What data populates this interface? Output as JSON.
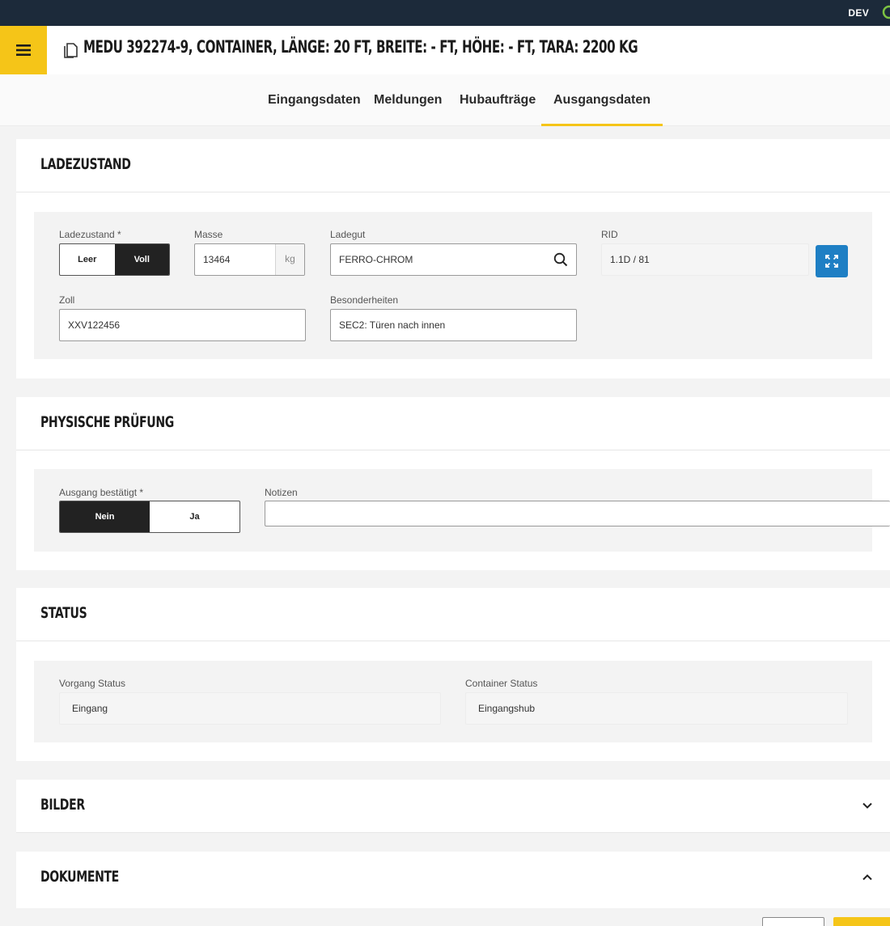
{
  "topbar": {
    "env": "DEV"
  },
  "header": {
    "title": "MEDU 392274-9, Container, Länge: 20 ft, Breite: - ft, Höhe: - ft, Tara: 2200 kg"
  },
  "tabs": [
    {
      "label": "Eingangsdaten"
    },
    {
      "label": "Meldungen"
    },
    {
      "label": "Hubaufträge"
    },
    {
      "label": "Ausgangsdaten"
    }
  ],
  "ladezustand": {
    "title": "LADEZUSTAND",
    "ladezustand_label": "Ladezustand *",
    "options": [
      "Leer",
      "Voll"
    ],
    "selected": "Voll",
    "masse_label": "Masse",
    "masse_value": "13464",
    "masse_unit": "kg",
    "ladegut_label": "Ladegut",
    "ladegut_value": "FERRO-CHROM",
    "rid_label": "RID",
    "rid_value": "1.1D / 81",
    "zoll_label": "Zoll",
    "zoll_value": "XXV122456",
    "besonderheiten_label": "Besonderheiten",
    "besonderheiten_value": "SEC2: Türen nach innen"
  },
  "pruefung": {
    "title": "PHYSISCHE PRÜFUNG",
    "ausgang_label": "Ausgang bestätigt *",
    "options": [
      "Nein",
      "Ja"
    ],
    "selected": "Nein",
    "notizen_label": "Notizen",
    "notizen_value": ""
  },
  "status": {
    "title": "STATUS",
    "vorgang_label": "Vorgang Status",
    "vorgang_value": "Eingang",
    "container_label": "Container Status",
    "container_value": "Eingangshub"
  },
  "bilder": {
    "title": "BILDER"
  },
  "dokumente": {
    "title": "DOKUMENTE"
  },
  "colors": {
    "accent": "#f5c518",
    "topbar": "#1c2a3a",
    "blue": "#1e7fc4",
    "dark": "#222222"
  }
}
